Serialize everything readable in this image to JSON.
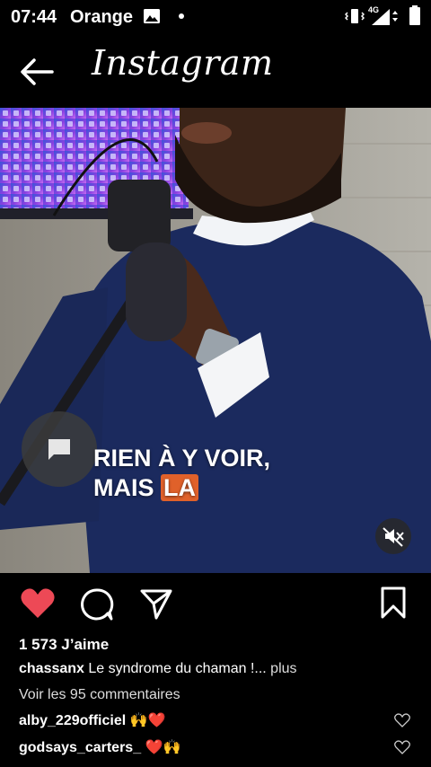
{
  "status_bar": {
    "time": "07:44",
    "carrier": "Orange",
    "network": "4G",
    "icons": [
      "gallery-icon",
      "dot-icon",
      "vibrate-icon",
      "signal-icon",
      "battery-icon"
    ]
  },
  "header": {
    "title": "Instagram",
    "back_icon": "arrow-left-icon"
  },
  "video": {
    "caption_line1": "RIEN À Y VOIR,",
    "caption_line2_prefix": "MAIS ",
    "caption_line2_highlight": "LA",
    "highlight_color": "#e0612a",
    "comment_icon": "speech-bubble-icon",
    "mute_icon": "speaker-muted-icon"
  },
  "actions": {
    "like_icon": "heart-filled-icon",
    "like_color": "#ed4956",
    "comment_icon": "comment-icon",
    "share_icon": "paper-plane-icon",
    "save_icon": "bookmark-icon"
  },
  "post": {
    "likes": "1 573 J’aime",
    "author": "chassanx",
    "caption_text": "Le syndrome du chaman !...",
    "more": "plus",
    "view_comments": "Voir les 95 commentaires"
  },
  "comments": [
    {
      "user": "alby_229officiel",
      "text": "🙌❤️"
    },
    {
      "user": "godsays_carters_",
      "text": "❤️🙌"
    }
  ]
}
